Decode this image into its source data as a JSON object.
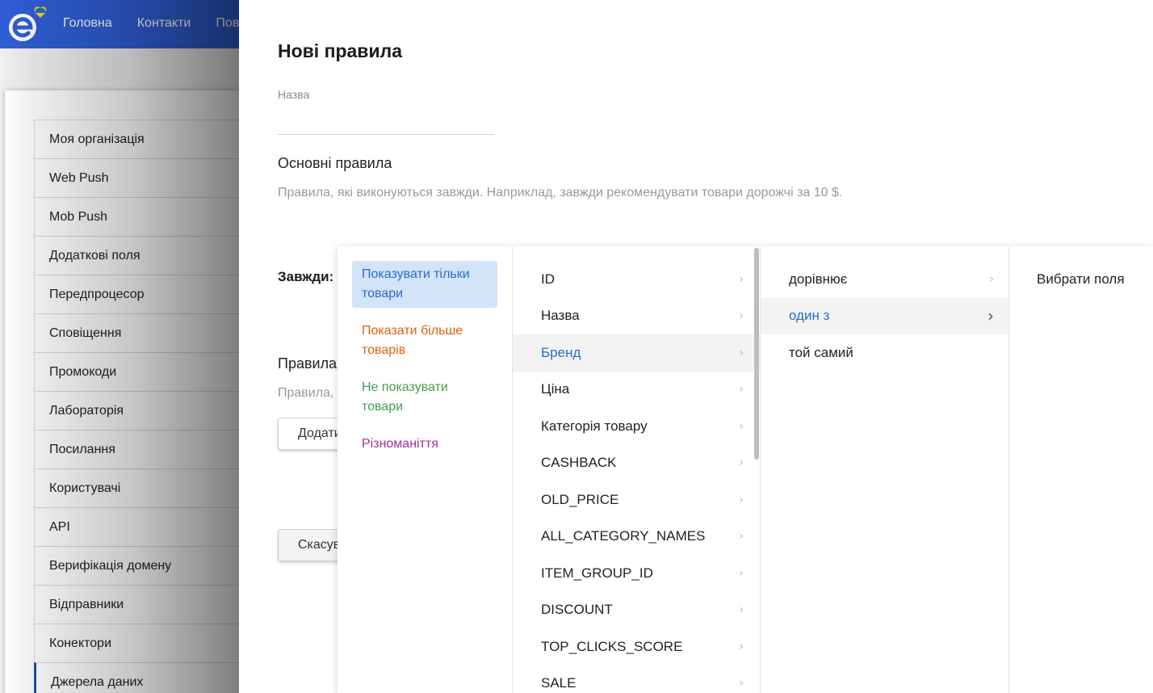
{
  "nav": {
    "items": [
      "Головна",
      "Контакти",
      "Пові"
    ]
  },
  "colors": {
    "brand": "#2f5fd6",
    "selected_bg": "#d3e3f8",
    "accent_text": "#2d6bc9",
    "mode_show_more": "#d9620f",
    "mode_hide": "#4a9a4f",
    "mode_variety": "#a22fa0"
  },
  "sidebar": {
    "items": [
      "Моя організація",
      "Web Push",
      "Mob Push",
      "Додаткові поля",
      "Передпроцесор",
      "Сповіщення",
      "Промокоди",
      "Лабораторія",
      "Посилання",
      "Користувачі",
      "API",
      "Верифікація домену",
      "Відправники",
      "Конектори",
      "Джерела даних"
    ]
  },
  "drawer": {
    "title": "Нові правила",
    "name_label": "Назва",
    "name_value": "",
    "main_rules_title": "Основні правила",
    "main_rules_desc": "Правила, які виконуються завжди. Наприклад, завжди рекомендувати товари дорожчі за 10 $.",
    "always_label": "Завжди:",
    "rules_title_partial": "Правила",
    "rules_desc_partial": "Правила,",
    "add_button": "Додати",
    "cancel_button": "Скасув"
  },
  "cascader": {
    "modes": [
      {
        "label": "Показувати тільки товари",
        "color": "#2d6bc9",
        "selected": true
      },
      {
        "label": "Показати більше товарів",
        "color": "#d9620f",
        "selected": false
      },
      {
        "label": "Не показувати товари",
        "color": "#4a9a4f",
        "selected": false
      },
      {
        "label": "Різноманіття",
        "color": "#a22fa0",
        "selected": false
      }
    ],
    "fields": [
      "ID",
      "Назва",
      "Бренд",
      "Ціна",
      "Категорія товару",
      "CASHBACK",
      "OLD_PRICE",
      "ALL_CATEGORY_NAMES",
      "ITEM_GROUP_ID",
      "DISCOUNT",
      "TOP_CLICKS_SCORE",
      "SALE"
    ],
    "fields_selected": "Бренд",
    "operators": [
      "дорівнює",
      "один з",
      "той самий"
    ],
    "operators_selected": "один з",
    "values_label": "Вибрати поля"
  }
}
